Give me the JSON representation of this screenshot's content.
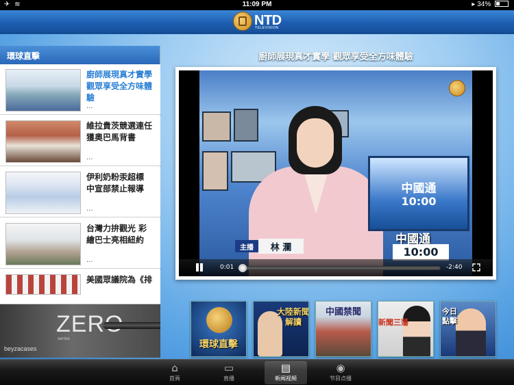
{
  "status_bar": {
    "time": "11:09 PM",
    "battery": "34%",
    "battery_level": 0.34
  },
  "header": {
    "brand": "NTD",
    "brand_sub": "TELEVISION"
  },
  "sidebar": {
    "title": "環球直擊",
    "items": [
      {
        "title": "廚師展現真才實學 觀眾享受全方味體驗",
        "more": "...",
        "active": true
      },
      {
        "title": "維拉貴茨競選連任 獲奧巴馬背書",
        "more": "..."
      },
      {
        "title": "伊利奶粉汞超標 中宣部禁止報導",
        "more": "..."
      },
      {
        "title": "台灣力拚觀光 彩繪巴士亮相紐約",
        "more": "..."
      },
      {
        "title": "美國眾議院為《排",
        "more": ""
      }
    ]
  },
  "ad": {
    "title": "ZERO",
    "series": "series",
    "brand": "beyzacases"
  },
  "video": {
    "title": "廚師展現真才實學 觀眾享受全方味體驗",
    "current_time": "0:01",
    "remaining_time": "-2:40",
    "progress": 0.01,
    "monitor_title": "中國通",
    "monitor_time": "10:00",
    "lower_title": "中國通",
    "lower_time": "10:00",
    "anchor_badge": "主播",
    "anchor_name": "林 瀾"
  },
  "programs": [
    {
      "label": "環球直擊"
    },
    {
      "label": "大陸新聞解讀"
    },
    {
      "label": "中國禁聞"
    },
    {
      "label": "新聞三藩"
    },
    {
      "label": "今日點擊"
    }
  ],
  "tabs": [
    {
      "label": "首頁",
      "icon": "home-icon"
    },
    {
      "label": "直播",
      "icon": "tv-icon"
    },
    {
      "label": "新闻视频",
      "icon": "clapper-icon",
      "active": true
    },
    {
      "label": "节目点播",
      "icon": "compass-icon"
    }
  ],
  "colors": {
    "accent": "#2a7fd4",
    "header": "#1d5fb2"
  }
}
